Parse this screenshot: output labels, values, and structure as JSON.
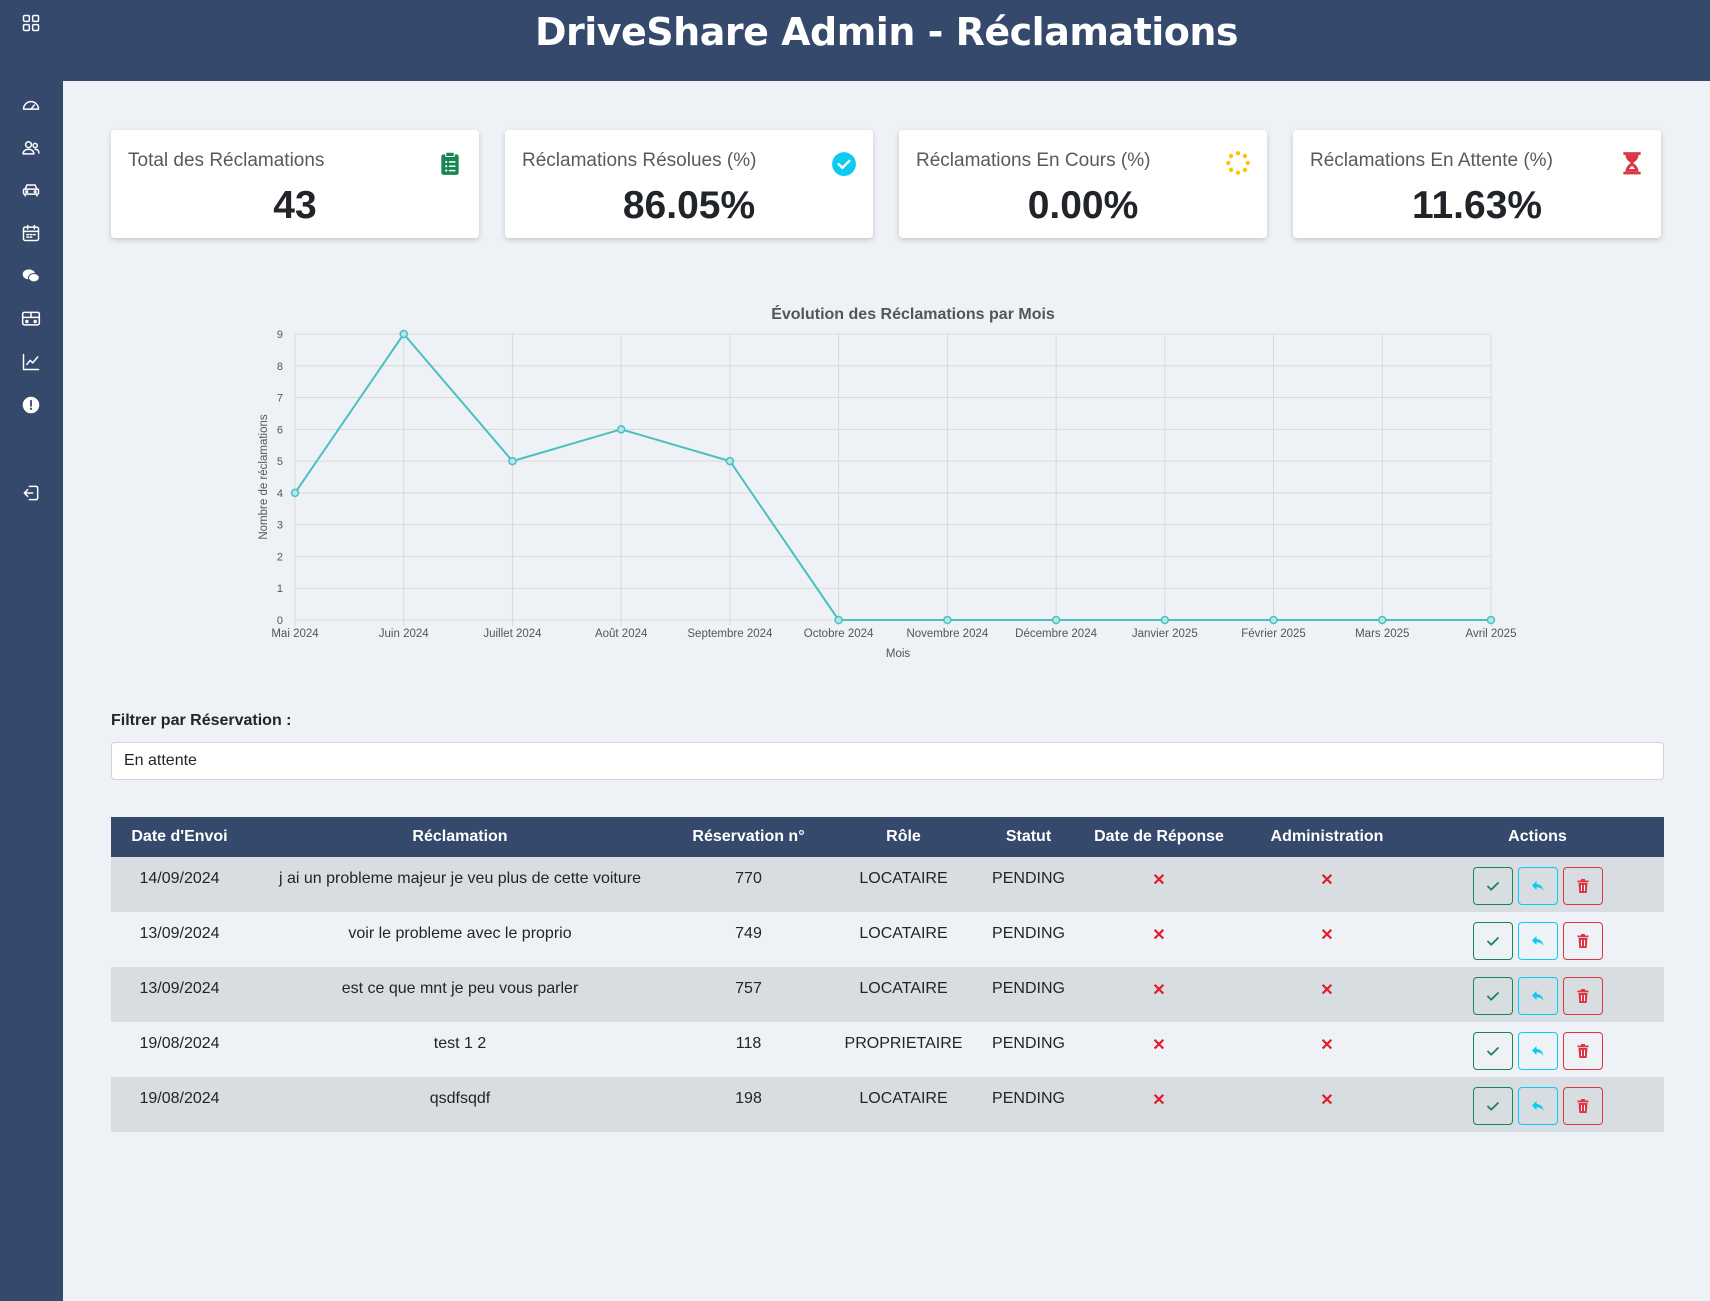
{
  "header": {
    "title": "DriveShare Admin - Réclamations"
  },
  "sidebar": {
    "items": [
      {
        "icon": "grid-icon"
      },
      {
        "icon": "speedometer-icon"
      },
      {
        "icon": "users-icon"
      },
      {
        "icon": "car-icon"
      },
      {
        "icon": "calendar-icon"
      },
      {
        "icon": "chat-icon"
      },
      {
        "icon": "bus-icon"
      },
      {
        "icon": "chart-icon"
      },
      {
        "icon": "alert-icon"
      },
      {
        "icon": "logout-icon"
      }
    ]
  },
  "stats": [
    {
      "label": "Total des Réclamations",
      "value": "43",
      "icon": "clipboard-icon",
      "color": "#198754"
    },
    {
      "label": "Réclamations Résolues (%)",
      "value": "86.05%",
      "icon": "check-circle-icon",
      "color": "#0dcaf0"
    },
    {
      "label": "Réclamations En Cours (%)",
      "value": "0.00%",
      "icon": "spinner-icon",
      "color": "#ffc107"
    },
    {
      "label": "Réclamations En Attente (%)",
      "value": "11.63%",
      "icon": "hourglass-icon",
      "color": "#dc3545"
    }
  ],
  "chart_data": {
    "type": "line",
    "title": "Évolution des Réclamations par Mois",
    "xlabel": "Mois",
    "ylabel": "Nombre de réclamations",
    "categories": [
      "Mai 2024",
      "Juin 2024",
      "Juillet 2024",
      "Août 2024",
      "Septembre 2024",
      "Octobre 2024",
      "Novembre 2024",
      "Décembre 2024",
      "Janvier 2025",
      "Février 2025",
      "Mars 2025",
      "Avril 2025"
    ],
    "values": [
      4,
      9,
      5,
      6,
      5,
      0,
      0,
      0,
      0,
      0,
      0,
      0
    ],
    "ylim": [
      0,
      9
    ],
    "yticks": [
      "0",
      "1",
      "2",
      "3",
      "4",
      "5",
      "6",
      "7",
      "8",
      "9"
    ],
    "grid": true,
    "color": "#4bc0c0"
  },
  "filter": {
    "label": "Filtrer par Réservation :",
    "value": "En attente"
  },
  "table": {
    "headers": [
      "Date d'Envoi",
      "Réclamation",
      "Réservation n°",
      "Rôle",
      "Statut",
      "Date de Réponse",
      "Administration",
      "Actions"
    ],
    "rows": [
      {
        "date": "14/09/2024",
        "text": "j ai un probleme majeur je veu plus de cette voiture",
        "reservation": "770",
        "role": "LOCATAIRE",
        "status": "PENDING",
        "response": "✕",
        "admin": "✕"
      },
      {
        "date": "13/09/2024",
        "text": "voir le probleme avec le proprio",
        "reservation": "749",
        "role": "LOCATAIRE",
        "status": "PENDING",
        "response": "✕",
        "admin": "✕"
      },
      {
        "date": "13/09/2024",
        "text": "est ce que mnt je peu vous parler",
        "reservation": "757",
        "role": "LOCATAIRE",
        "status": "PENDING",
        "response": "✕",
        "admin": "✕"
      },
      {
        "date": "19/08/2024",
        "text": "test 1 2",
        "reservation": "118",
        "role": "PROPRIETAIRE",
        "status": "PENDING",
        "response": "✕",
        "admin": "✕"
      },
      {
        "date": "19/08/2024",
        "text": "qsdfsqdf",
        "reservation": "198",
        "role": "LOCATAIRE",
        "status": "PENDING",
        "response": "✕",
        "admin": "✕"
      }
    ]
  },
  "colors": {
    "primary": "#34496b",
    "background": "#eef2f6",
    "success": "#198754",
    "info": "#0dcaf0",
    "danger": "#dc3545"
  }
}
